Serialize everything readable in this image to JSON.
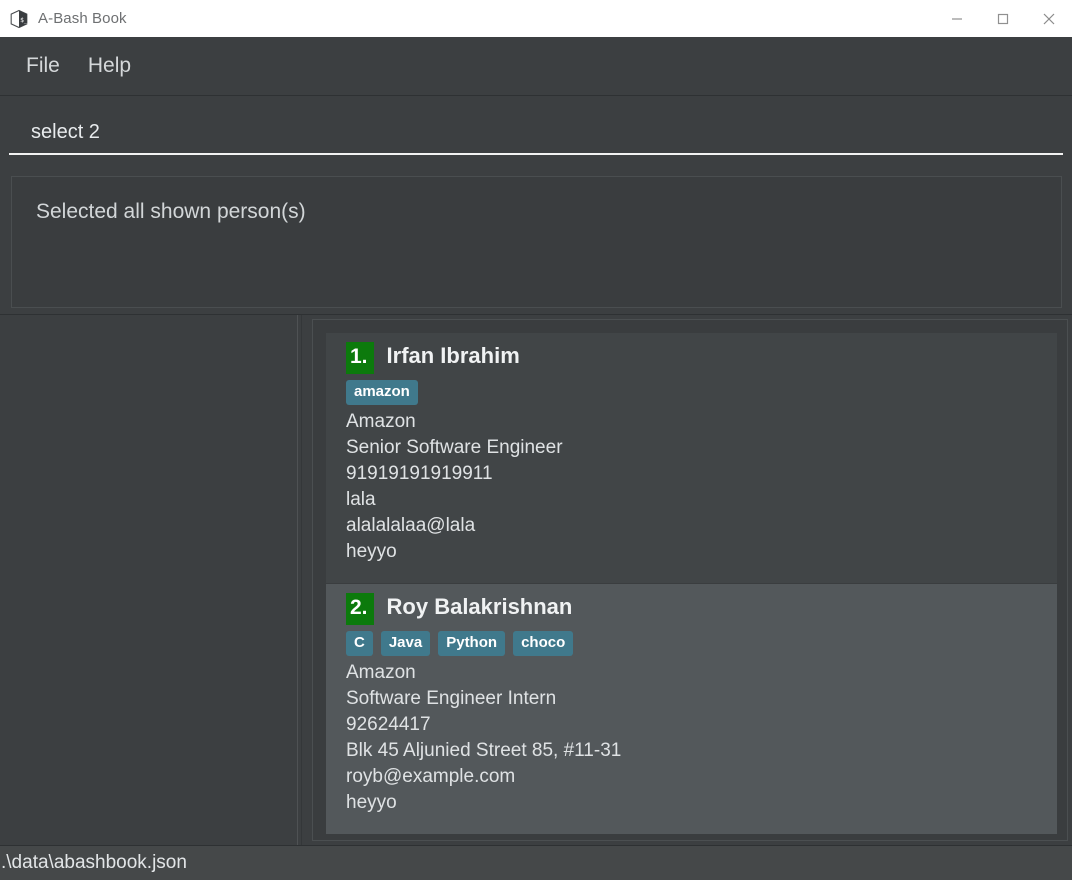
{
  "window": {
    "title": "A-Bash Book",
    "icon": "app-cube-icon",
    "controls": {
      "minimize": "minimize-icon",
      "maximize": "maximize-icon",
      "close": "close-icon"
    }
  },
  "menubar": {
    "items": [
      {
        "label": "File"
      },
      {
        "label": "Help"
      }
    ]
  },
  "command": {
    "value": "select 2",
    "placeholder": "Enter command here..."
  },
  "result": {
    "text": "Selected all shown person(s)"
  },
  "person_list": {
    "scroll_position": "top",
    "persons": [
      {
        "index": "1.",
        "name": "Irfan Ibrahim",
        "selected": false,
        "tags": [
          "amazon"
        ],
        "fields": [
          "Amazon",
          "Senior Software Engineer",
          "91919191919911",
          "lala",
          "alalalalaa@lala",
          "heyyo"
        ]
      },
      {
        "index": "2.",
        "name": "Roy Balakrishnan",
        "selected": true,
        "tags": [
          "C",
          "Java",
          "Python",
          "choco"
        ],
        "fields": [
          "Amazon",
          "Software Engineer Intern",
          "92624417",
          "Blk 45 Aljunied Street 85, #11-31",
          "royb@example.com",
          "heyyo"
        ]
      }
    ]
  },
  "statusbar": {
    "save_location": ".\\data\\abashbook.json"
  },
  "colors": {
    "window_chrome": "#ffffff",
    "app_background": "#3c3f41",
    "card_background": "#414547",
    "card_selected_background": "#53585b",
    "index_badge_green": "#0c7a0c",
    "tag_teal": "#40798c",
    "text_primary": "#dfe2e4",
    "title_text": "#6e7072"
  }
}
